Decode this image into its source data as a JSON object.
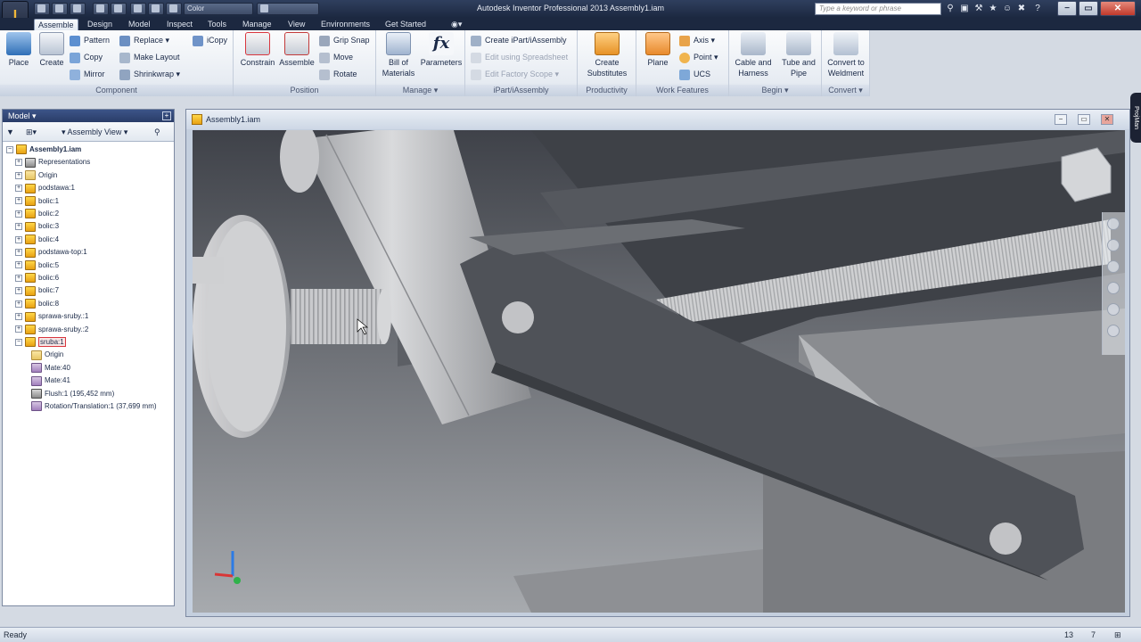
{
  "titlebar": {
    "app_button": "I",
    "color_combo": "Color",
    "window_title": "Autodesk Inventor Professional 2013    Assembly1.iam",
    "search_placeholder": "Type a keyword or phrase"
  },
  "tabs": [
    "Assemble",
    "Design",
    "Model",
    "Inspect",
    "Tools",
    "Manage",
    "View",
    "Environments",
    "Get Started"
  ],
  "ribbon": {
    "component": {
      "label": "Component",
      "place": "Place",
      "create": "Create",
      "pattern": "Pattern",
      "copy": "Copy",
      "mirror": "Mirror",
      "replace": "Replace",
      "make_layout": "Make Layout",
      "shrinkwrap": "Shrinkwrap",
      "icopy": "iCopy"
    },
    "position": {
      "label": "Position",
      "constrain": "Constrain",
      "assemble": "Assemble",
      "grip_snap": "Grip Snap",
      "move": "Move",
      "rotate": "Rotate"
    },
    "manage": {
      "label": "Manage",
      "bom_line1": "Bill of",
      "bom_line2": "Materials",
      "parameters": "Parameters"
    },
    "ipart": {
      "label": "iPart/iAssembly",
      "create": "Create iPart/iAssembly",
      "edit_spreadsheet": "Edit using Spreadsheet",
      "edit_factory": "Edit Factory Scope"
    },
    "productivity": {
      "label": "Productivity",
      "line1": "Create",
      "line2": "Substitutes"
    },
    "work_features": {
      "label": "Work Features",
      "plane": "Plane",
      "axis": "Axis",
      "point": "Point",
      "ucs": "UCS"
    },
    "begin": {
      "label": "Begin",
      "cable_line1": "Cable and",
      "cable_line2": "Harness",
      "tube_line1": "Tube and",
      "tube_line2": "Pipe"
    },
    "convert": {
      "label": "Convert",
      "line1": "Convert to",
      "line2": "Weldment"
    }
  },
  "browser": {
    "header": "Model",
    "view_dropdown": "Assembly View",
    "tree": [
      {
        "label": "Assembly1.iam",
        "indent": 0,
        "icon": "assembly-icon",
        "bold": true
      },
      {
        "label": "Representations",
        "indent": 1,
        "icon": "representations-icon"
      },
      {
        "label": "Origin",
        "indent": 1,
        "icon": "folder-icon"
      },
      {
        "label": "podstawa:1",
        "indent": 1,
        "icon": "grounded-part-icon"
      },
      {
        "label": "bolic:1",
        "indent": 1,
        "icon": "part-icon"
      },
      {
        "label": "bolic:2",
        "indent": 1,
        "icon": "part-icon"
      },
      {
        "label": "bolic:3",
        "indent": 1,
        "icon": "part-icon"
      },
      {
        "label": "bolic:4",
        "indent": 1,
        "icon": "part-icon"
      },
      {
        "label": "podstawa-top:1",
        "indent": 1,
        "icon": "part-icon"
      },
      {
        "label": "bolic:5",
        "indent": 1,
        "icon": "part-icon"
      },
      {
        "label": "bolic:6",
        "indent": 1,
        "icon": "part-icon"
      },
      {
        "label": "bolic:7",
        "indent": 1,
        "icon": "part-icon"
      },
      {
        "label": "bolic:8",
        "indent": 1,
        "icon": "part-icon"
      },
      {
        "label": "sprawa-sruby.:1",
        "indent": 1,
        "icon": "part-icon"
      },
      {
        "label": "sprawa-sruby.:2",
        "indent": 1,
        "icon": "part-icon"
      },
      {
        "label": "sruba:1",
        "indent": 1,
        "icon": "part-icon",
        "selected": true
      },
      {
        "label": "Origin",
        "indent": 2,
        "icon": "folder-icon"
      },
      {
        "label": "Mate:40",
        "indent": 2,
        "icon": "mate-constraint-icon"
      },
      {
        "label": "Mate:41",
        "indent": 2,
        "icon": "mate-constraint-icon"
      },
      {
        "label": "Flush:1 (195,452 mm)",
        "indent": 2,
        "icon": "flush-constraint-icon"
      },
      {
        "label": "Rotation/Translation:1 (37,699 mm)",
        "indent": 2,
        "icon": "rotation-translation-icon"
      }
    ]
  },
  "document": {
    "title": "Assembly1.iam"
  },
  "rightdock": {
    "label": "ProjMan"
  },
  "status": {
    "text": "Ready",
    "count1": "13",
    "count2": "7"
  },
  "colors": {
    "titlebar": "#1c2840",
    "ribbon": "#e6ebf2",
    "selection": "#d9363e",
    "part_icon": "#f5c024",
    "model_face": "#4a4d53",
    "cylinder": "#bfc1c4"
  }
}
